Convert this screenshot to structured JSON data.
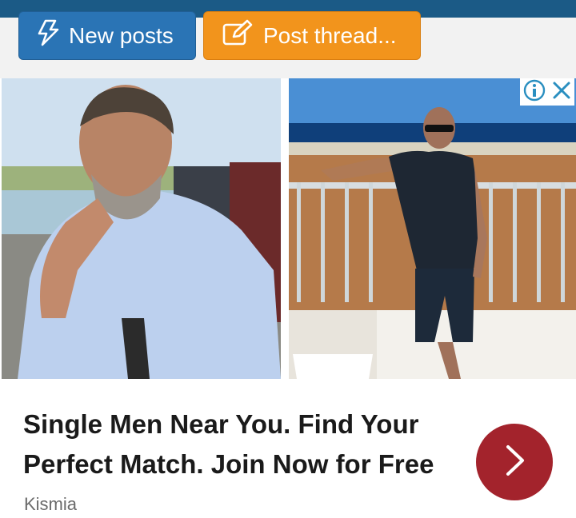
{
  "toolbar": {
    "new_posts_label": "New posts",
    "post_thread_label": "Post thread..."
  },
  "ad": {
    "headline_line1": "Single Men Near You. Find Your",
    "headline_line2": "Perfect Match. Join Now for Free",
    "advertiser": "Kismia",
    "icons": [
      "info-icon",
      "close-icon",
      "chevron-right-icon"
    ],
    "colors": {
      "topbar": "#1b5a86",
      "new_posts_button": "#2a74b5",
      "post_thread_button": "#f2941c",
      "cta_button": "#a3232c",
      "adchoices": "#2a8fc0"
    }
  }
}
